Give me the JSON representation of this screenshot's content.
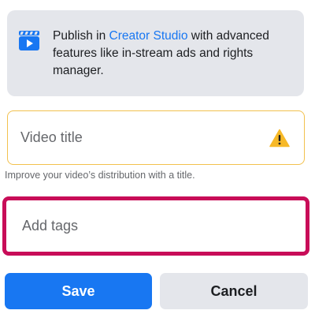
{
  "banner": {
    "text_before": "Publish in ",
    "link_text": "Creator Studio",
    "text_after": " with advanced features like in-stream ads and rights manager.",
    "icon": "creator-studio-icon"
  },
  "title_field": {
    "placeholder": "Video title",
    "value": "",
    "icon": "warning-icon",
    "helper": "Improve your video’s distribution with a title."
  },
  "tags_field": {
    "placeholder": "Add tags",
    "value": ""
  },
  "buttons": {
    "save": "Save",
    "cancel": "Cancel"
  },
  "colors": {
    "accent": "#1877f2",
    "warning": "#f7b928",
    "focus_border": "#c80d58",
    "surface": "#e4e6eb"
  }
}
